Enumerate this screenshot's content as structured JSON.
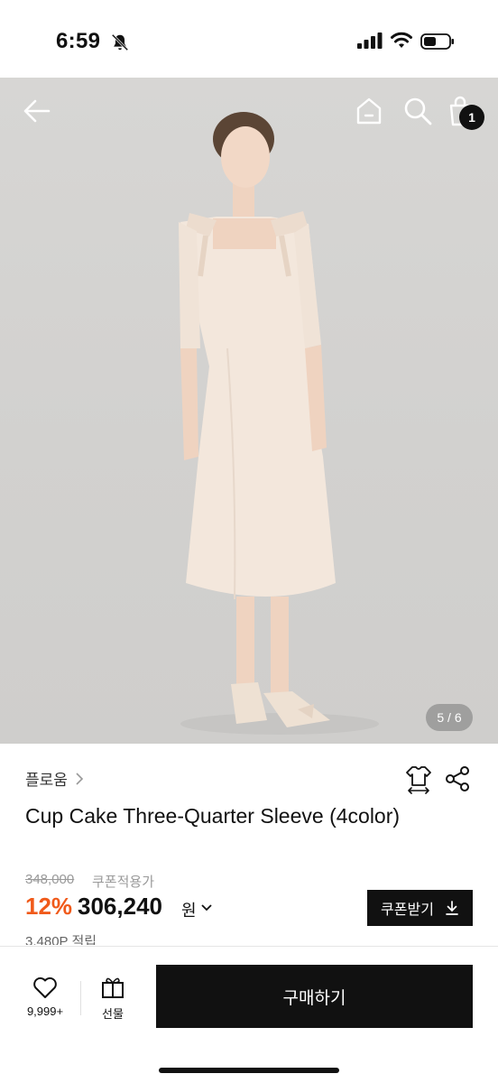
{
  "status_bar": {
    "time": "6:59"
  },
  "nav": {
    "cart_count": "1"
  },
  "gallery": {
    "page_indicator": "5 / 6"
  },
  "product": {
    "brand": "플로움",
    "title": "Cup Cake Three-Quarter Sleeve (4color)",
    "original_price": "348,000",
    "coupon_note": "쿠폰적용가",
    "discount_rate": "12%",
    "sale_price": "306,240",
    "currency": "원",
    "coupon_button_label": "쿠폰받기",
    "points": "3,480P 적립"
  },
  "bottom_bar": {
    "wish_count": "9,999+",
    "gift_label": "선물",
    "buy_label": "구매하기"
  },
  "colors": {
    "accent": "#f05a1a",
    "primary": "#111111",
    "muted": "#9a9a9a"
  }
}
